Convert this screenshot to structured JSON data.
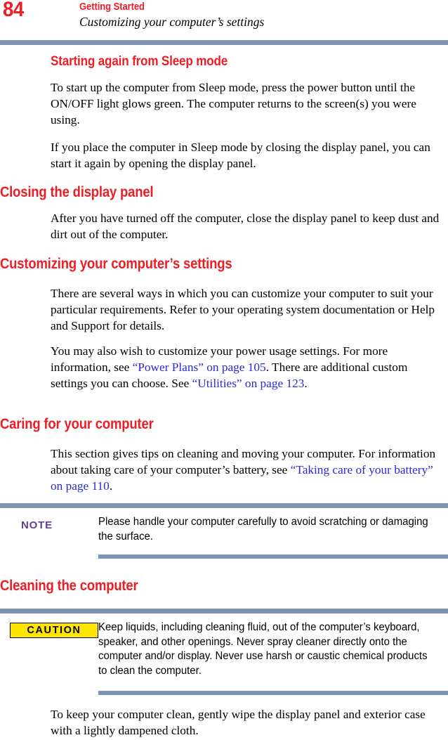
{
  "page": {
    "number": "84",
    "chapter": "Getting Started",
    "section": "Customizing your computer’s settings"
  },
  "colors": {
    "heading_red": "#ee1c25",
    "rule_blue": "#7d95b2",
    "link_blue": "#2a2ad6",
    "note_purple": "#5b3f9e",
    "caution_yellow": "#ffe500"
  },
  "sections": {
    "sleep_mode": {
      "heading": "Starting again from Sleep mode",
      "paragraph_1": "To start up the computer from Sleep mode, press the power button until the ON/OFF light glows green. The computer returns to the screen(s) you were using.",
      "paragraph_2": "If you place the computer in Sleep mode by closing the display panel, you can start it again by opening the display panel."
    },
    "closing_display": {
      "heading": "Closing the display panel",
      "paragraph_1": "After you have turned off the computer, close the display panel to keep dust and dirt out of the computer."
    },
    "customizing": {
      "heading": "Customizing your computer’s settings",
      "paragraph_1": "There are several ways in which you can customize your computer to suit your particular requirements. Refer to your operating system documentation or Help and Support for details.",
      "paragraph_2_part_1": "You may also wish to customize your power usage settings. For more information, see ",
      "paragraph_2_link_1": "“Power Plans” on page 105",
      "paragraph_2_part_2": ". There are additional custom settings you can choose. See ",
      "paragraph_2_link_2": "“Utilities” on page 123",
      "paragraph_2_part_3": "."
    },
    "caring": {
      "heading": "Caring for your computer",
      "paragraph_1_part_1": "This section gives tips on cleaning and moving your computer. For information about taking care of your computer’s battery, see ",
      "paragraph_1_link_1": "“Taking care of your battery” on page 110",
      "paragraph_1_part_2": "."
    },
    "cleaning": {
      "heading": "Cleaning the computer",
      "paragraph_1": "To keep your computer clean, gently wipe the display panel and exterior case with a lightly dampened cloth."
    }
  },
  "callouts": {
    "note": {
      "label": "NOTE",
      "text": "Please handle your computer carefully to avoid scratching or damaging the surface."
    },
    "caution": {
      "label": "CAUTION",
      "text": "Keep liquids, including cleaning fluid, out of the computer’s keyboard, speaker, and other openings. Never spray cleaner directly onto the computer and/or display. Never use harsh or caustic chemical products to clean the computer."
    }
  }
}
